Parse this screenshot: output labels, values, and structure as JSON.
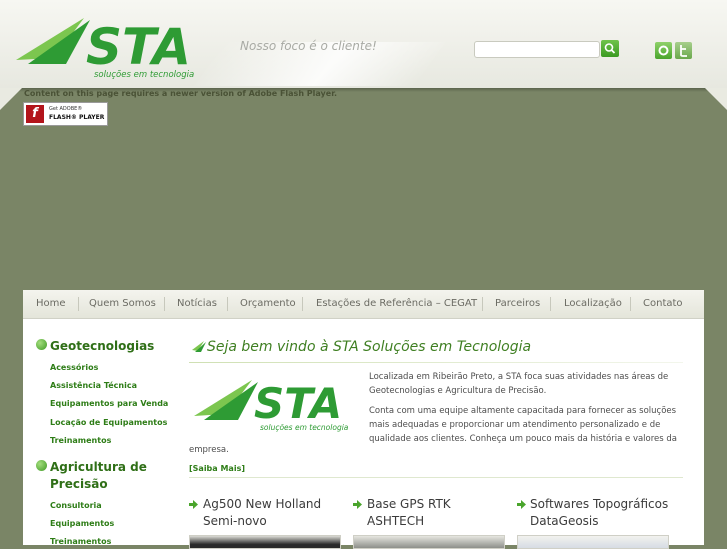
{
  "header": {
    "logo_text": "STA",
    "logo_tagline": "soluções em tecnologia",
    "slogan": "Nosso foco é o cliente!",
    "search": {
      "value": "",
      "placeholder": ""
    },
    "social": [
      "orkut-icon",
      "twitter-icon"
    ]
  },
  "flash": {
    "message": "Content on this page requires a newer version of Adobe Flash Player.",
    "badge_get": "Get ADOBE®",
    "badge_name": "FLASH® PLAYER"
  },
  "nav": {
    "items": [
      "Home",
      "Quem Somos",
      "Notícias",
      "Orçamento",
      "Estações de Referência – CEGAT",
      "Parceiros",
      "Localização",
      "Contato"
    ]
  },
  "sidebar": {
    "categories": [
      {
        "title": "Geotecnologias",
        "links": [
          "Acessórios",
          "Assistência Técnica",
          "Equipamentos para Venda",
          "Locação de Equipamentos",
          "Treinamentos"
        ]
      },
      {
        "title": "Agricultura de Precisão",
        "links": [
          "Consultoria",
          "Equipamentos",
          "Treinamentos"
        ]
      }
    ]
  },
  "main": {
    "welcome": "Seja bem vindo à STA Soluções em Tecnologia",
    "para1": "Localizada em Ribeirão Preto, a STA foca suas atividades nas áreas de Geotecnologias e Agricultura de Precisão.",
    "para2_a": "Conta com uma equipe altamente capacitada para fornecer as soluções mais adequadas e proporcionar um atendimento personalizado e de qualidade aos clientes. Conheça um pouco mais da história e valores da",
    "para2_b": "empresa.",
    "saiba_mais": "[Saiba Mais]",
    "products": [
      {
        "title": "Ag500 New Holland Semi-novo"
      },
      {
        "title": "Base GPS RTK ASHTECH"
      },
      {
        "title": "Softwares Topográficos DataGeosis"
      }
    ]
  },
  "colors": {
    "brand_green": "#2e9b34",
    "link_green": "#2e7d17",
    "background": "#7a8566"
  }
}
